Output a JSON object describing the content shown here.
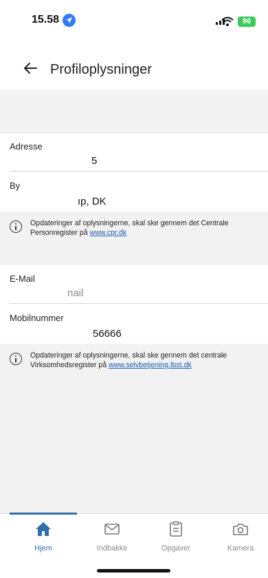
{
  "status_bar": {
    "time": "15.58",
    "battery": "86"
  },
  "header": {
    "title": "Profiloplysninger"
  },
  "fields": {
    "adresse": {
      "label": "Adresse",
      "value": "5"
    },
    "by": {
      "label": "By",
      "value": "ıp, DK"
    },
    "email": {
      "label": "E-Mail",
      "value": "nail"
    },
    "mobil": {
      "label": "Mobilnummer",
      "value": "56666"
    }
  },
  "notices": {
    "cpr": {
      "text": "Opdateringer af oplysningerne, skal ske gennem det Centrale Personregister på ",
      "link": "www.cpr.dk"
    },
    "virk": {
      "text": "Opdateringer af oplysningerne, skal ske gennem det centrale Virksomhedsregister på ",
      "link": "www.selvbetjening.lbst.dk"
    }
  },
  "nav": {
    "items": [
      {
        "label": "Hjem",
        "icon": "home-icon",
        "active": true
      },
      {
        "label": "Indbakke",
        "icon": "mail-icon",
        "active": false
      },
      {
        "label": "Opgaver",
        "icon": "clipboard-icon",
        "active": false
      },
      {
        "label": "Kamera",
        "icon": "camera-icon",
        "active": false
      }
    ]
  },
  "colors": {
    "accent": "#2f6ea8",
    "link": "#1a5fb4",
    "panel": "#f2f2f2"
  }
}
